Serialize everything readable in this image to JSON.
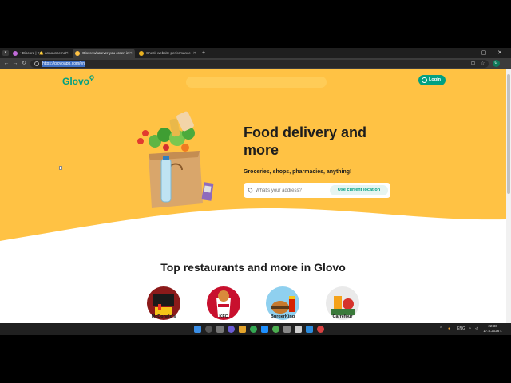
{
  "browser": {
    "tabs": [
      {
        "title": "• Discord | #🔔 announcements",
        "favicon_color": "#c06ad8",
        "active": false
      },
      {
        "title": "Glovo: whatever you order, in...",
        "favicon_color": "#ffc244",
        "active": true
      },
      {
        "title": "Check website performance a...",
        "favicon_color": "#e8b020",
        "active": false
      }
    ],
    "new_tab": "+",
    "url": "https://glovoapp.com/en",
    "window_controls": [
      "–",
      "▢",
      "✕"
    ]
  },
  "header": {
    "logo": "Glovo",
    "login_label": "Login"
  },
  "hero": {
    "title": "Food delivery and more",
    "subtitle": "Groceries, shops, pharmacies, anything!",
    "address_placeholder": "What's your address?",
    "use_location_label": "Use current location"
  },
  "restaurants": {
    "heading": "Top restaurants and more in Glovo",
    "items": [
      {
        "name": "McDonald's",
        "color": "#8b1a1a"
      },
      {
        "name": "KFC",
        "color": "#c8102e"
      },
      {
        "name": "BurgerKing",
        "color": "#5aa9d6"
      },
      {
        "name": "Carrefour",
        "color": "#f2f2f2"
      }
    ]
  },
  "taskbar": {
    "language": "ENG",
    "time": "22:36",
    "date": "17.8.2026 г."
  },
  "colors": {
    "brand_yellow": "#ffc244",
    "brand_green": "#00a082"
  }
}
